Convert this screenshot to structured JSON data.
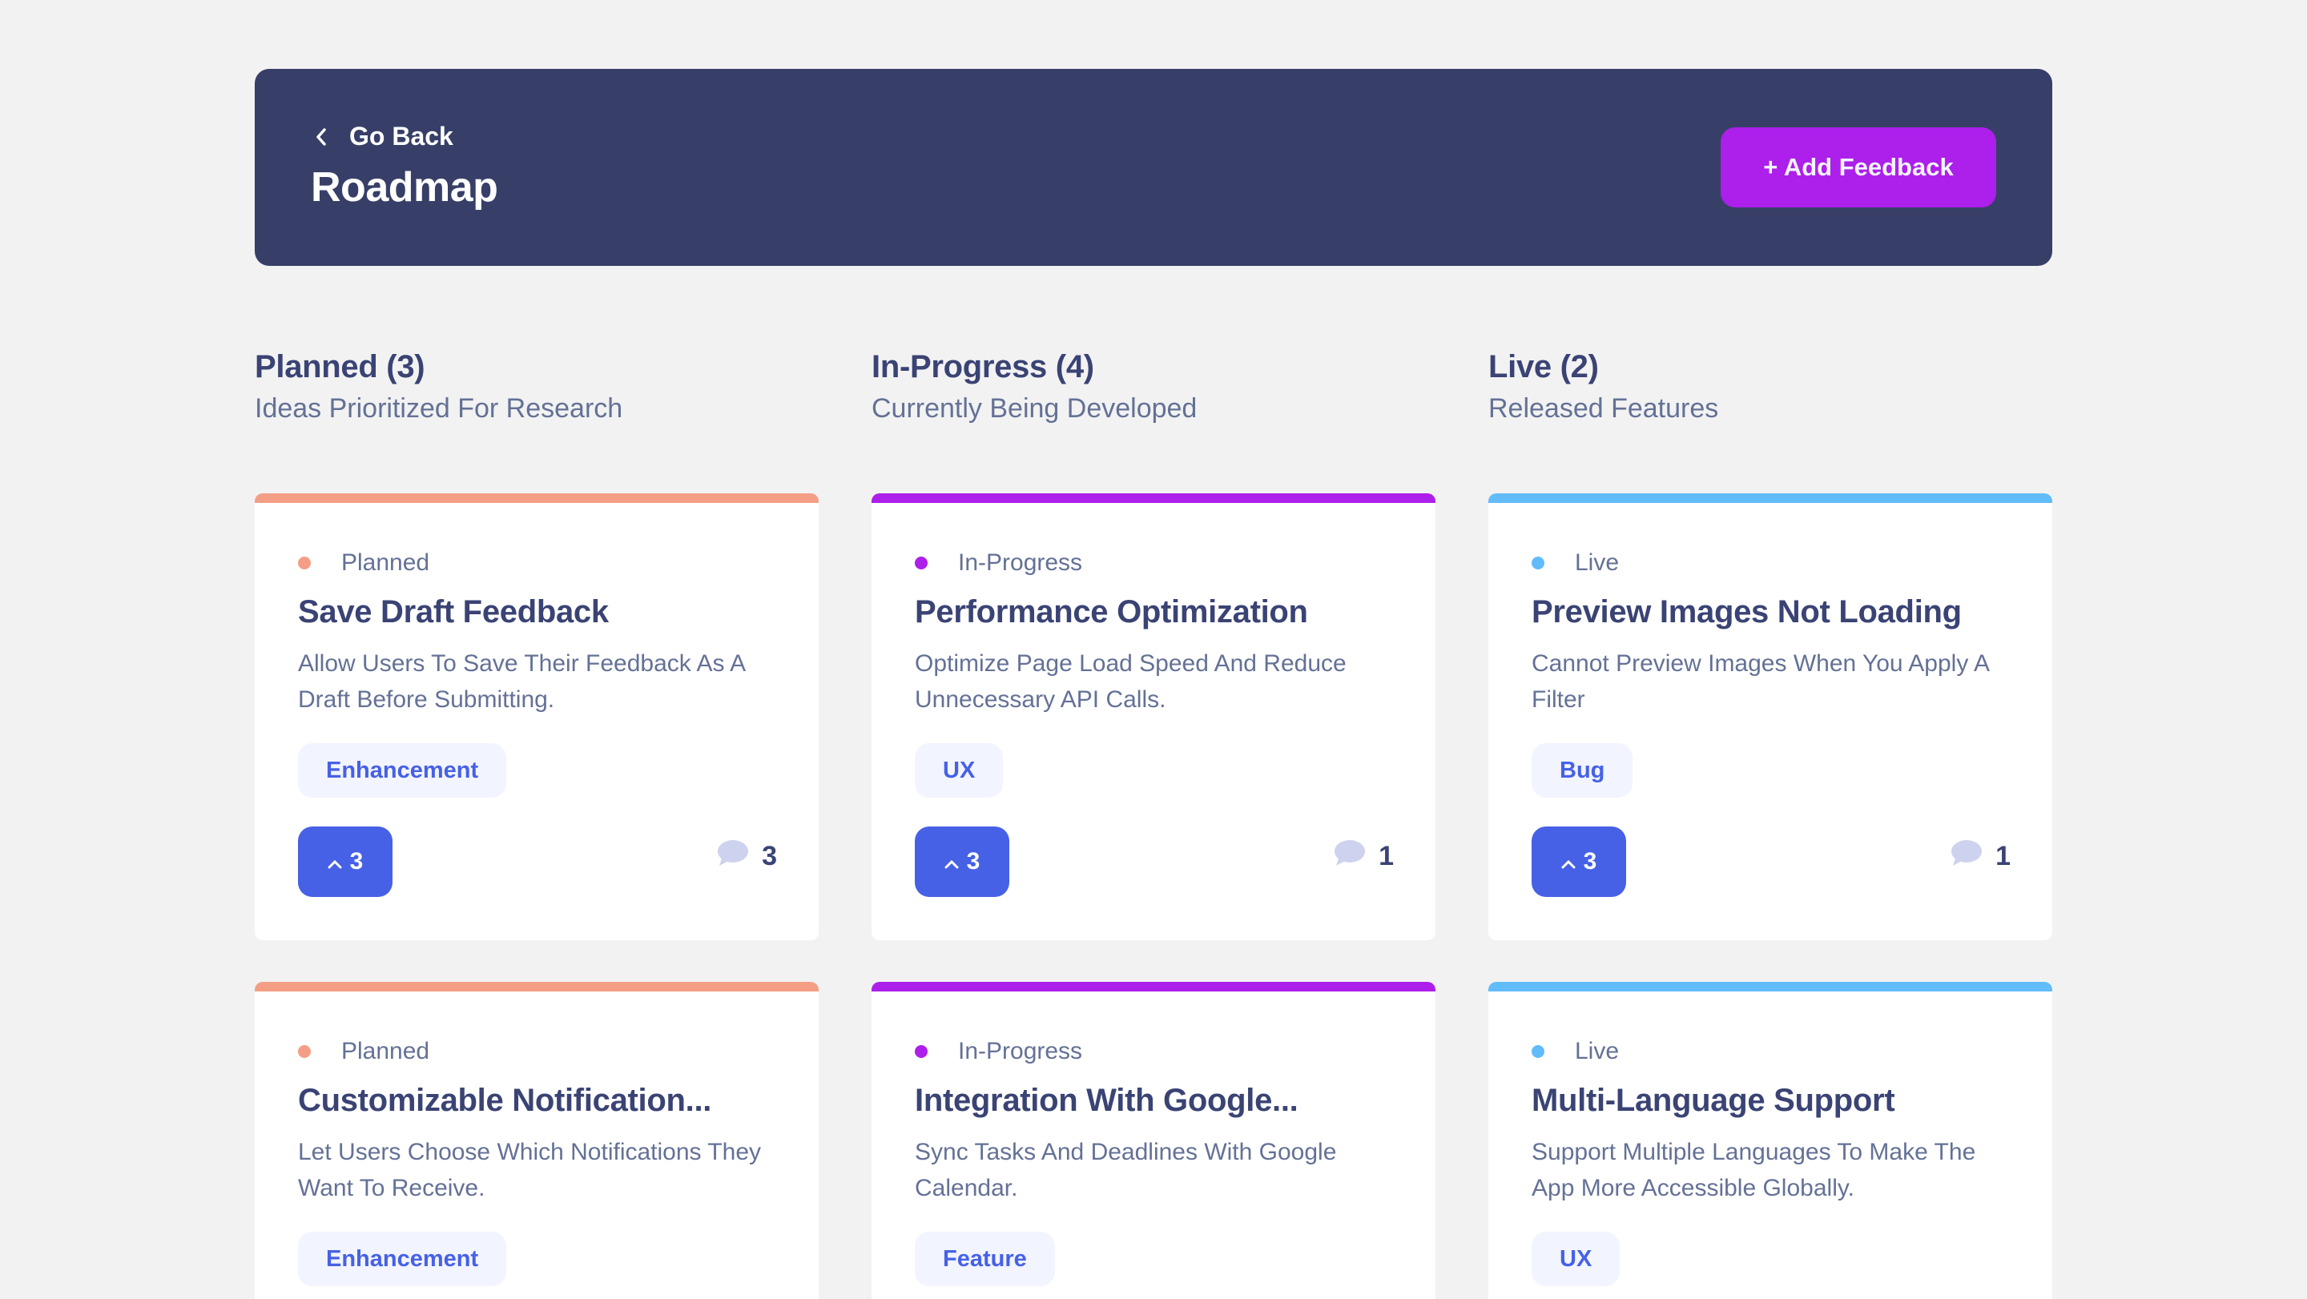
{
  "header": {
    "back_label": "Go Back",
    "title": "Roadmap",
    "add_label": "+ Add Feedback"
  },
  "colors": {
    "planned": "#f49f85",
    "in_progress": "#ad1fea",
    "live": "#62bcfa",
    "header_bg": "#373f68",
    "upvote_bg": "#4661e6"
  },
  "columns": [
    {
      "title": "Planned (3)",
      "subtitle": "Ideas Prioritized For Research",
      "cards": [
        {
          "status": "Planned",
          "title": "Save Draft Feedback",
          "desc": "Allow Users To Save Their Feedback As A Draft Before Submitting.",
          "tag": "Enhancement",
          "upvotes": "3",
          "comments": "3"
        },
        {
          "status": "Planned",
          "title": "Customizable Notification...",
          "desc": "Let Users Choose Which Notifications They Want To Receive.",
          "tag": "Enhancement",
          "upvotes": "",
          "comments": ""
        }
      ]
    },
    {
      "title": "In-Progress (4)",
      "subtitle": "Currently Being Developed",
      "cards": [
        {
          "status": "In-Progress",
          "title": "Performance Optimization",
          "desc": "Optimize Page Load Speed And Reduce Unnecessary API Calls.",
          "tag": "UX",
          "upvotes": "3",
          "comments": "1"
        },
        {
          "status": "In-Progress",
          "title": "Integration With Google...",
          "desc": "Sync Tasks And Deadlines With Google Calendar.",
          "tag": "Feature",
          "upvotes": "",
          "comments": ""
        }
      ]
    },
    {
      "title": "Live (2)",
      "subtitle": "Released Features",
      "cards": [
        {
          "status": "Live",
          "title": "Preview Images Not Loading",
          "desc": "Cannot Preview Images When You Apply A Filter",
          "tag": "Bug",
          "upvotes": "3",
          "comments": "1"
        },
        {
          "status": "Live",
          "title": "Multi-Language Support",
          "desc": "Support Multiple Languages To Make The App More Accessible Globally.",
          "tag": "UX",
          "upvotes": "",
          "comments": ""
        }
      ]
    }
  ]
}
